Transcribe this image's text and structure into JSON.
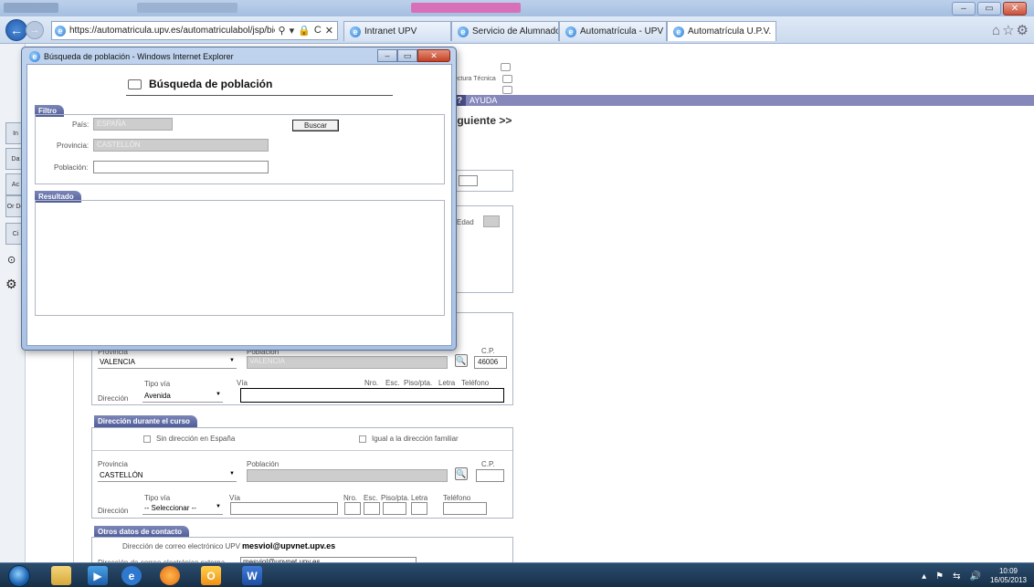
{
  "browser": {
    "window_buttons": [
      "–",
      "▭",
      "✕"
    ],
    "url": "https://automatricula.upv.es/automatriculabol/jsp/bie/l",
    "address_tools": [
      "⚲",
      "▾",
      "🔒",
      "C",
      "✕"
    ],
    "tabs": [
      {
        "label": "Intranet UPV",
        "active": false
      },
      {
        "label": "Servicio de Alumnado: ...",
        "active": false
      },
      {
        "label": "Automatrícula - UPV",
        "active": false
      },
      {
        "label": "Automatrícula U.P.V.",
        "active": true
      }
    ],
    "right_icons": "⌂☆⚙"
  },
  "background_page": {
    "side_tabs": [
      "In",
      "Da",
      "Ac",
      "Or De",
      "Ci"
    ],
    "arq_tecnica": "ectura Técnica",
    "ayuda": "AYUDA",
    "siguiente": "iguiente >>",
    "edad_label": "Edad",
    "familiar": {
      "provincia_label": "Provincia",
      "provincia_value": "VALENCIA",
      "poblacion_label": "Población",
      "poblacion_value": "VALENCIA",
      "cp_label": "C.P.",
      "cp_value": "46006",
      "tipo_via_label": "Tipo vía",
      "tipo_via_value": "Avenida",
      "direccion_label": "Dirección",
      "via_label": "Vía",
      "nro_label": "Nro.",
      "esc_label": "Esc.",
      "piso_label": "Piso/pta.",
      "letra_label": "Letra",
      "telefono_label": "Teléfono"
    },
    "curso": {
      "header": "Dirección durante el curso",
      "sin_direccion": "Sin dirección en España",
      "igual_familiar": "Igual a la dirección familiar",
      "provincia_label": "Provincia",
      "provincia_value": "CASTELLÓN",
      "poblacion_label": "Población",
      "cp_label": "C.P.",
      "tipo_via_label": "Tipo vía",
      "tipo_via_value": "-- Seleccionar --",
      "direccion_label": "Dirección",
      "via_label": "Vía",
      "nro_label": "Nro.",
      "esc_label": "Esc.",
      "piso_label": "Piso/pta.",
      "letra_label": "Letra",
      "telefono_label": "Teléfono"
    },
    "contacto": {
      "header": "Otros datos de contacto",
      "email_upv_label": "Dirección de correo electrónico UPV",
      "email_upv_value": "mesviol@upvnet.upv.es",
      "email_ext_label": "Dirección de correo electrónico externa",
      "email_ext_value": "mesviol@upvnet.upv.es"
    }
  },
  "popup": {
    "title": "Búsqueda de población - Windows Internet Explorer",
    "heading": "Búsqueda de población",
    "filtro_header": "Filtro",
    "pais_label": "País:",
    "pais_value": "ESPAÑA",
    "provincia_label": "Provincia:",
    "provincia_value": "CASTELLÓN",
    "poblacion_label": "Población:",
    "poblacion_value": "",
    "buscar_label": "Buscar",
    "resultado_header": "Resultado"
  },
  "taskbar": {
    "apps": [
      "explorer",
      "media",
      "ie",
      "firefox",
      "outlook",
      "word"
    ],
    "time": "10:09",
    "date": "16/05/2013"
  },
  "colors": {
    "section_header": "#5a649f",
    "purple_bar": "#8688bb",
    "taskbar": "#1f3d5c"
  }
}
